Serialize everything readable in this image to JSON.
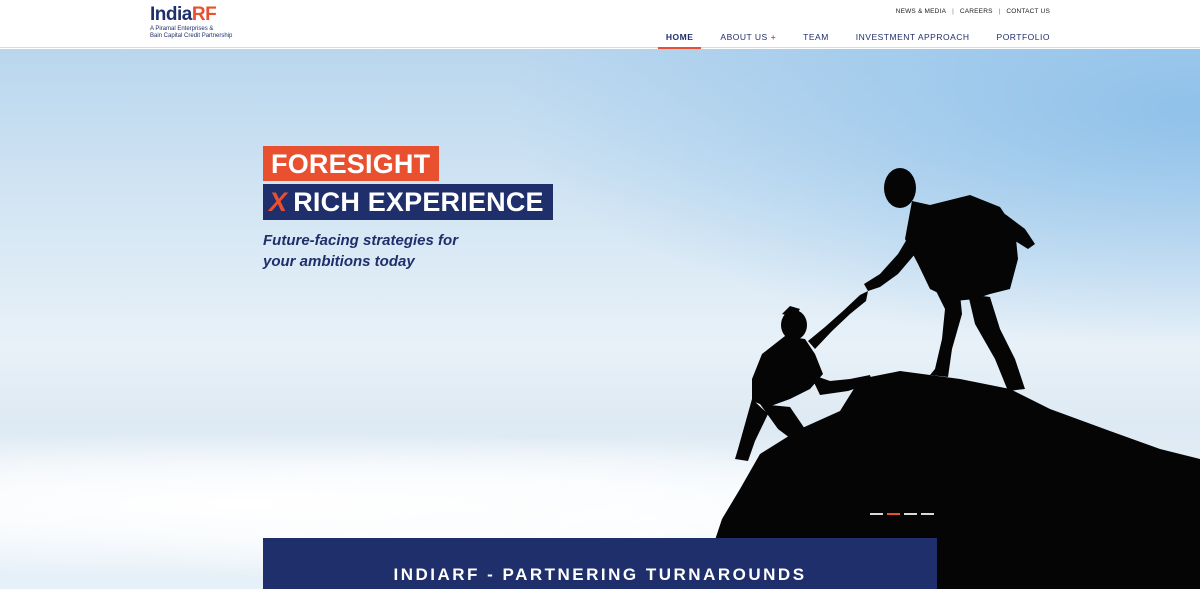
{
  "logo": {
    "india": "India",
    "rf": "RF",
    "sub_line1": "A Piramal Enterprises &",
    "sub_line2": "Bain Capital Credit Partnership"
  },
  "utility_nav": [
    "NEWS & MEDIA",
    "CAREERS",
    "CONTACT US"
  ],
  "main_nav": [
    {
      "label": "HOME",
      "active": true
    },
    {
      "label": "ABOUT US",
      "has_plus": true,
      "plus": "+"
    },
    {
      "label": "TEAM"
    },
    {
      "label": "INVESTMENT APPROACH"
    },
    {
      "label": "PORTFOLIO"
    }
  ],
  "hero": {
    "line1": "FORESIGHT",
    "line2_x": "X",
    "line2": "RICH EXPERIENCE",
    "tagline_1": "Future-facing strategies for",
    "tagline_2": "your ambitions today",
    "slides": 4,
    "active_slide": 2
  },
  "banner": {
    "text": "INDIARF - PARTNERING TURNAROUNDS"
  },
  "colors": {
    "navy": "#1f2f6b",
    "orange": "#e8502f"
  }
}
